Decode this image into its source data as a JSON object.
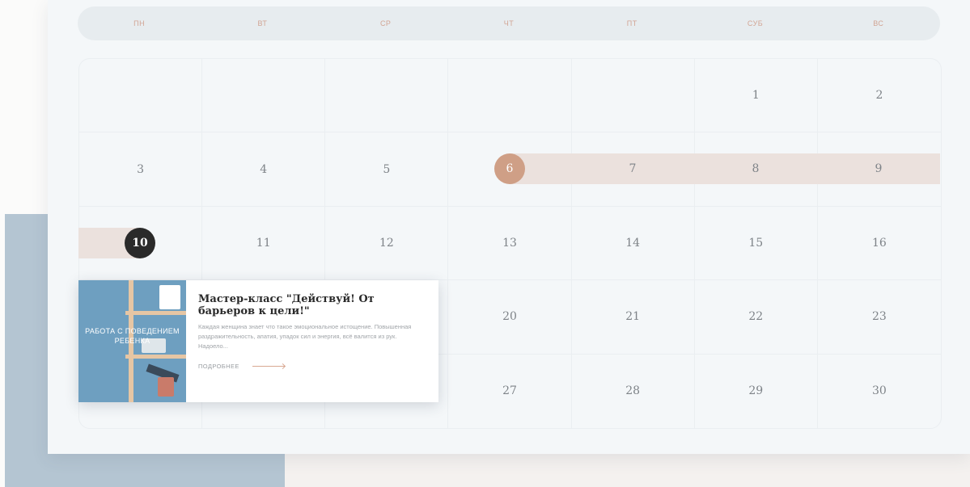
{
  "weekdays": [
    "ПН",
    "ВТ",
    "СР",
    "ЧТ",
    "ПТ",
    "СУБ",
    "ВС"
  ],
  "calendar": {
    "weeks": [
      [
        "",
        "",
        "",
        "",
        "",
        "1",
        "2"
      ],
      [
        "3",
        "4",
        "5",
        "6",
        "7",
        "8",
        "9"
      ],
      [
        "10",
        "11",
        "12",
        "13",
        "14",
        "15",
        "16"
      ],
      [
        "",
        "",
        "",
        "20",
        "21",
        "22",
        "23"
      ],
      [
        "",
        "",
        "",
        "27",
        "28",
        "29",
        "30"
      ]
    ],
    "highlight_start_day": "6",
    "today_day": "10",
    "colors": {
      "accent": "#cf9f86",
      "range_fill": "#ebe1dd",
      "today": "#2a2a2a"
    }
  },
  "event": {
    "thumb_caption": "РАБОТА С ПОВЕДЕНИЕМ РЕБЕНКА",
    "title": "Мастер-класс \"Действуй! От барьеров к цели!\"",
    "description": "Каждая женщина знает что такое эмоциональное истощение. Повышенная раздражительность, апатия, упадок сил и энергия, всё валится из рук. Надоело...",
    "more_label": "ПОДРОБНЕЕ"
  }
}
